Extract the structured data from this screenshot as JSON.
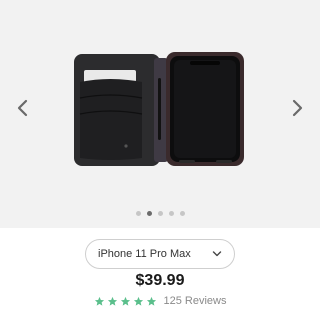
{
  "product": {
    "variant": {
      "selected": "iPhone 11 Pro Max"
    },
    "price": "$39.99",
    "rating": {
      "stars": 5,
      "max": 5,
      "color": "#5bbf8c",
      "reviews_label": "125 Reviews"
    }
  },
  "gallery": {
    "image_count": 5,
    "active_index": 1,
    "prev_icon": "chevron-left-icon",
    "next_icon": "chevron-right-icon"
  }
}
